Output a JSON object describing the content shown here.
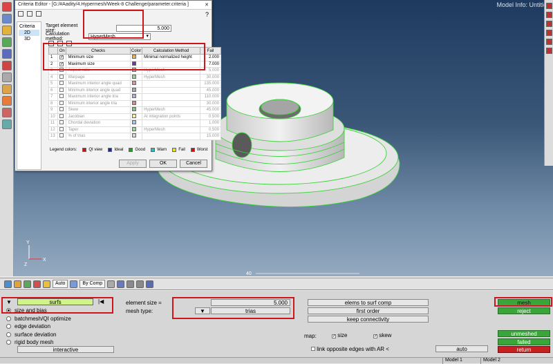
{
  "viewport": {
    "model_info": "Model Info: Untitled",
    "scale_label": "40",
    "axis_labels": {
      "y": "Y",
      "x": "X",
      "z": "Z"
    }
  },
  "dialog": {
    "title": "Criteria Editor - [G:/#Aadity/4.Hypermesh/Week-8 Challenge/parameter.criteria ]",
    "help": "?",
    "close": "✕",
    "tree": {
      "root": "Criteria",
      "items": [
        "2D",
        "3D"
      ]
    },
    "target_label": "Target element size:",
    "target_value": "5.000",
    "method_label": "Calculation method:",
    "method_value": "HyperMesh",
    "columns": [
      "",
      "On",
      "Checks",
      "Color",
      "Calculation Method",
      "Fail"
    ],
    "rows": [
      {
        "n": "1",
        "check": "Minimum size",
        "color": "#e8b45a",
        "method": "Minimal normalized height",
        "fail": "2.000",
        "on": true
      },
      {
        "n": "2",
        "check": "Maximum size",
        "color": "#6a3a9c",
        "method": "",
        "fail": "7.000",
        "on": true
      },
      {
        "n": "3",
        "check": "Aspect ratio",
        "color": "#b9b9b9",
        "method": "HyperMesh",
        "fail": "5.000",
        "on": false
      },
      {
        "n": "4",
        "check": "Warpage",
        "color": "#9ccf9c",
        "method": "HyperMesh",
        "fail": "30.000",
        "on": false
      },
      {
        "n": "5",
        "check": "Maximum interior angle quad",
        "color": "#d09a9a",
        "method": "",
        "fail": "135.000",
        "on": false
      },
      {
        "n": "6",
        "check": "Minimum interior angle quad",
        "color": "#a9a9a9",
        "method": "",
        "fail": "45.000",
        "on": false
      },
      {
        "n": "7",
        "check": "Maximum interior angle tria",
        "color": "#b0b0d8",
        "method": "",
        "fail": "110.000",
        "on": false
      },
      {
        "n": "8",
        "check": "Minimum interior angle tria",
        "color": "#c89090",
        "method": "",
        "fail": "30.000",
        "on": false
      },
      {
        "n": "9",
        "check": "Skew",
        "color": "#8bbc8b",
        "method": "HyperMesh",
        "fail": "45.000",
        "on": false
      },
      {
        "n": "10",
        "check": "Jacobian",
        "color": "#f2f2a0",
        "method": "At integration points",
        "fail": "0.500",
        "on": false
      },
      {
        "n": "11",
        "check": "Chordal deviation",
        "color": "#a8c4e8",
        "method": "",
        "fail": "1.000",
        "on": false
      },
      {
        "n": "12",
        "check": "Taper",
        "color": "#9ad69a",
        "method": "HyperMesh",
        "fail": "0.500",
        "on": false
      },
      {
        "n": "13",
        "check": "% of trias",
        "color": "#d8d8d8",
        "method": "",
        "fail": "15.000",
        "on": false
      }
    ],
    "legend_label": "Legend colors:",
    "legend": [
      {
        "label": "QI view",
        "color": "#d01010"
      },
      {
        "label": "Ideal",
        "color": "#1a2a9c"
      },
      {
        "label": "Good",
        "color": "#20a020"
      },
      {
        "label": "Warn",
        "color": "#20c0c0"
      },
      {
        "label": "Fail",
        "color": "#e8e020"
      },
      {
        "label": "Worst",
        "color": "#d01010"
      }
    ],
    "buttons": {
      "apply": "Apply",
      "ok": "OK",
      "cancel": "Cancel"
    }
  },
  "toolbar": {
    "auto_dd": "Auto",
    "bycomp_dd": "By Comp"
  },
  "panel": {
    "selector": "surfs",
    "options": [
      "size and bias",
      "batchmesh/QI optimize",
      "edge deviation",
      "surface deviation",
      "rigid body mesh"
    ],
    "interactive": "interactive",
    "element_size_label": "element size =",
    "element_size_value": "5.000",
    "mesh_type_label": "mesh type:",
    "mesh_type_value": "trias",
    "toggles": [
      "elems to surf comp",
      "first order",
      "keep connectivity"
    ],
    "map_label": "map:",
    "map_size": "size",
    "map_skew": "skew",
    "link_label": "link opposite edges with AR <",
    "auto": "auto",
    "right_buttons": {
      "mesh": "mesh",
      "reject": "reject",
      "unmeshed": "unmeshed",
      "failed": "failed",
      "return": "return"
    }
  },
  "statusbar": {
    "tabs": [
      "Model 1",
      "Model 2"
    ]
  }
}
